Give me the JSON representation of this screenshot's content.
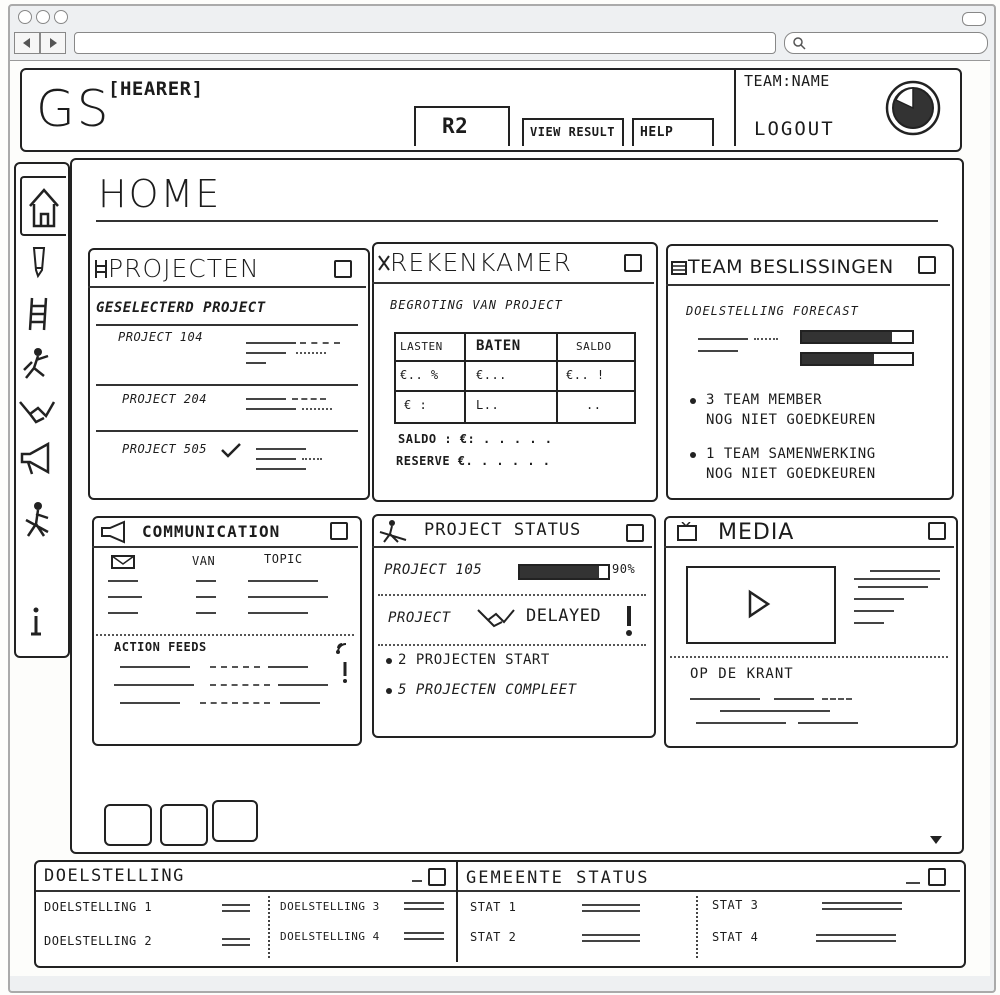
{
  "browser": {
    "back_icon": "arrow-left-icon",
    "forward_icon": "arrow-right-icon",
    "search_icon": "search-icon"
  },
  "header": {
    "logo": "GS",
    "subtitle": "[HEARER]",
    "round_button": "R2",
    "view_result": "VIEW RESULT",
    "help": "HELP",
    "team_name": "TEAM:NAME",
    "logout": "LOGOUT"
  },
  "page": {
    "title": "HOME"
  },
  "sidebar": {
    "items": [
      {
        "icon": "home-icon"
      },
      {
        "icon": "pencil-icon"
      },
      {
        "icon": "ladder-icon"
      },
      {
        "icon": "worker-icon"
      },
      {
        "icon": "handshake-icon"
      },
      {
        "icon": "megaphone-icon"
      },
      {
        "icon": "digging-icon"
      },
      {
        "icon": "info-icon"
      }
    ]
  },
  "projecten": {
    "title": "PROJECTEN",
    "subtitle": "GESELECTERD PROJECT",
    "items": [
      "PROJECT 104",
      "PROJECT 204",
      "PROJECT 505"
    ]
  },
  "rekenkamer": {
    "title": "REKENKAMER",
    "subtitle": "BEGROTING VAN PROJECT",
    "columns": [
      "LASTEN",
      "BATEN",
      "SALDO"
    ],
    "rows": [
      [
        "€.. %",
        "€...",
        "€.. !"
      ],
      [
        "€ :",
        "L..",
        ".."
      ]
    ],
    "saldo": "SALDO : €: . . .  . .",
    "reserve": "RESERVE €. . . .  . ."
  },
  "team": {
    "title": "TEAM BESLISSINGEN",
    "forecast": "DOELSTELLING FORECAST",
    "bullet1_line1": "3 TEAM MEMBER",
    "bullet1_line2": "NOG NIET GOEDKEUREN",
    "bullet2_line1": "1 TEAM SAMENWERKING",
    "bullet2_line2": "NOG NIET GOEDKEUREN"
  },
  "communication": {
    "title": "COMMUNICATION",
    "col_van": "VAN",
    "col_topic": "TOPIC",
    "action_feeds": "ACTION FEEDS"
  },
  "project_status": {
    "title": "PROJECT STATUS",
    "project_label": "PROJECT 105",
    "progress_percent": 90,
    "progress_text": "90%",
    "delayed_label": "PROJECT",
    "delayed_text": "DELAYED",
    "bullet1": "2 PROJECTEN START",
    "bullet2": "5 PROJECTEN COMPLEET"
  },
  "media": {
    "title": "MEDIA",
    "caption": "OP DE KRANT"
  },
  "doelstelling": {
    "title": "DOELSTELLING",
    "items": [
      "DOELSTELLING 1",
      "DOELSTELLING 2",
      "DOELSTELLING 3",
      "DOELSTELLING 4"
    ]
  },
  "gemeente": {
    "title": "GEMEENTE STATUS",
    "items": [
      "STAT 1",
      "STAT 2",
      "STAT 3",
      "STAT 4"
    ]
  }
}
